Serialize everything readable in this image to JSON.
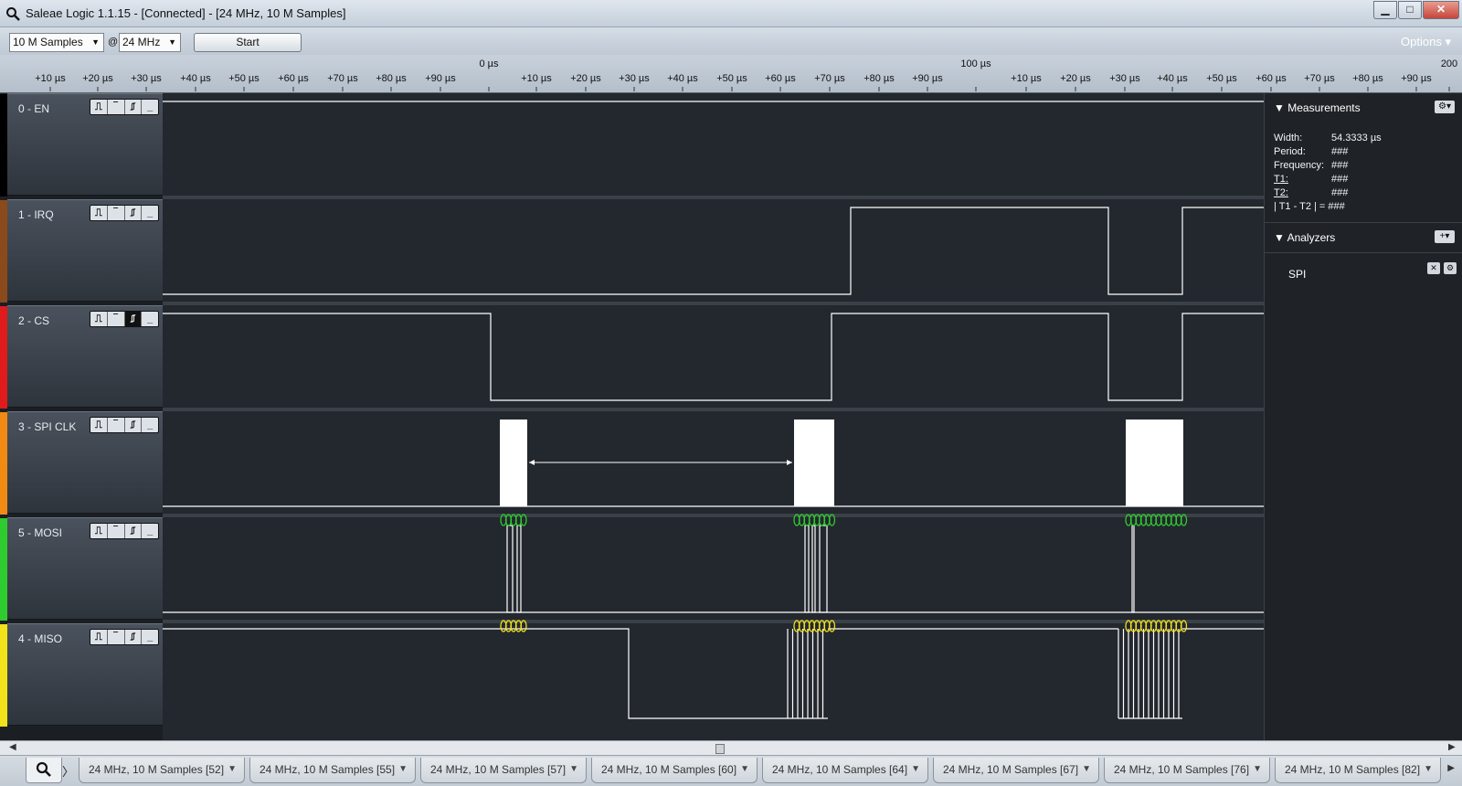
{
  "window": {
    "title": "Saleae Logic 1.1.15 - [Connected] - [24 MHz, 10 M Samples]",
    "minimize": "▁",
    "maximize": "□",
    "close": "✕"
  },
  "toolbar": {
    "samples_value": "10 M Samples",
    "at_sign": "@",
    "rate_value": "24 MHz",
    "start_label": "Start",
    "options_label": "Options ▾"
  },
  "ruler": {
    "labels": [
      "+10 µs",
      "+20 µs",
      "+30 µs",
      "+40 µs",
      "+50 µs",
      "+60 µs",
      "+70 µs",
      "+80 µs",
      "+90 µs",
      "0 µs",
      "+10 µs",
      "+20 µs",
      "+30 µs",
      "+40 µs",
      "+50 µs",
      "+60 µs",
      "+70 µs",
      "+80 µs",
      "+90 µs",
      "100 µs",
      "+10 µs",
      "+20 µs",
      "+30 µs",
      "+40 µs",
      "+50 µs",
      "+60 µs",
      "+70 µs",
      "+80 µs",
      "+90 µs",
      "200"
    ]
  },
  "channels": [
    {
      "name": "0 - EN",
      "color": "#000000"
    },
    {
      "name": "1 - IRQ",
      "color": "#8b4a1c"
    },
    {
      "name": "2 - CS",
      "color": "#e01b1b"
    },
    {
      "name": "3 - SPI CLK",
      "color": "#f08a12"
    },
    {
      "name": "5 - MOSI",
      "color": "#2ecc2e"
    },
    {
      "name": "4 - MISO",
      "color": "#f2e21a"
    }
  ],
  "trigger_buttons": [
    "⎍",
    "‾",
    "⎎",
    "_"
  ],
  "panel": {
    "measurements_title": "Measurements",
    "measurements": [
      {
        "label": "Width:",
        "value": "54.3333 µs"
      },
      {
        "label": "Period:",
        "value": "###"
      },
      {
        "label": "Frequency:",
        "value": "###"
      },
      {
        "label": "T1:",
        "value": "###"
      },
      {
        "label": "T2:",
        "value": "###"
      },
      {
        "label": "| T1 - T2 | =",
        "value": "###"
      }
    ],
    "analyzers_title": "Analyzers",
    "analyzer_item": "SPI",
    "gear": "⚙▾",
    "add": "+▾"
  },
  "tabs": [
    "24 MHz, 10 M Samples [52]",
    "24 MHz, 10 M Samples [55]",
    "24 MHz, 10 M Samples [57]",
    "24 MHz, 10 M Samples [60]",
    "24 MHz, 10 M Samples [64]",
    "24 MHz, 10 M Samples [67]",
    "24 MHz, 10 M Samples [76]",
    "24 MHz, 10 M Samples [82]"
  ],
  "tabs_next": "〉"
}
